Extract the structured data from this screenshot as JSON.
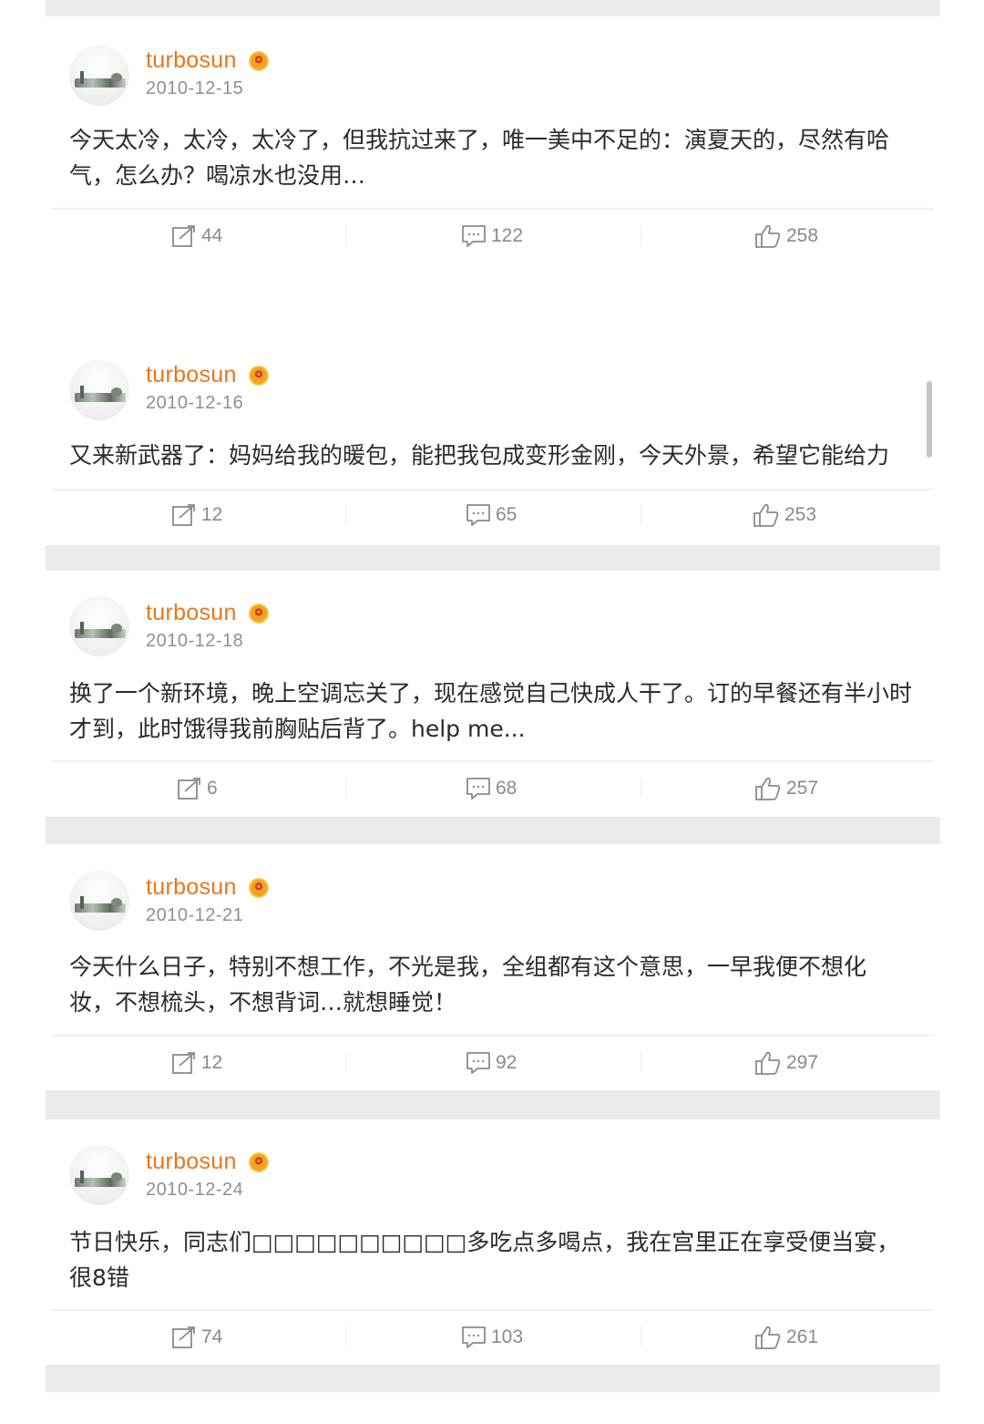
{
  "posts": [
    {
      "username": "turbosun",
      "date": "2010-12-15",
      "text": "今天太冷，太冷，太冷了，但我抗过来了，唯一美中不足的：演夏天的，尽然有哈气，怎么办？喝凉水也没用…",
      "reposts": "44",
      "comments": "122",
      "likes": "258"
    },
    {
      "username": "turbosun",
      "date": "2010-12-16",
      "text": "又来新武器了：妈妈给我的暖包，能把我包成变形金刚，今天外景，希望它能给力",
      "reposts": "12",
      "comments": "65",
      "likes": "253"
    },
    {
      "username": "turbosun",
      "date": "2010-12-18",
      "text": "换了一个新环境，晚上空调忘关了，现在感觉自己快成人干了。订的早餐还有半小时才到，此时饿得我前胸贴后背了。help me...",
      "reposts": "6",
      "comments": "68",
      "likes": "257"
    },
    {
      "username": "turbosun",
      "date": "2010-12-21",
      "text": "今天什么日子，特别不想工作，不光是我，全组都有这个意思，一早我便不想化妆，不想梳头，不想背词…就想睡觉！",
      "reposts": "12",
      "comments": "92",
      "likes": "297"
    },
    {
      "username": "turbosun",
      "date": "2010-12-24",
      "text": "节日快乐，同志们□□□□□□□□□□多吃点多喝点，我在宫里正在享受便当宴，很8错",
      "reposts": "74",
      "comments": "103",
      "likes": "261"
    }
  ],
  "icons": {
    "repost": "repost-icon",
    "comment": "comment-icon",
    "like": "like-icon",
    "verified": "verified-badge-icon"
  },
  "colors": {
    "username": "#e8761e",
    "meta": "#8f8f8f",
    "text": "#2b2b2b",
    "separator_band": "#ebebeb"
  }
}
